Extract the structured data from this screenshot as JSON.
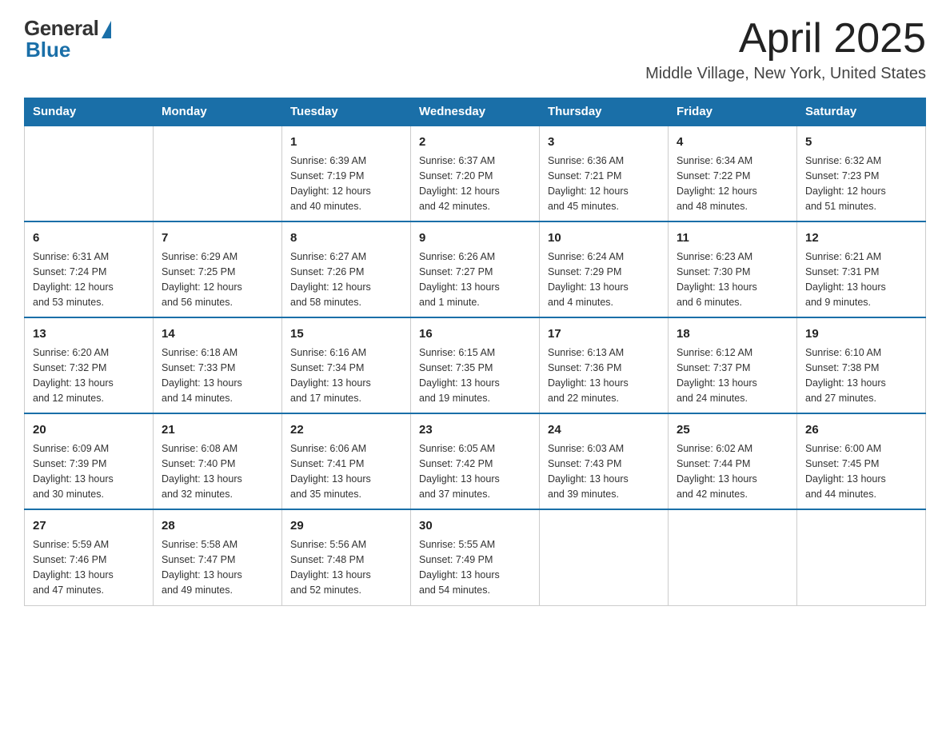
{
  "logo": {
    "general": "General",
    "blue": "Blue"
  },
  "title": "April 2025",
  "location": "Middle Village, New York, United States",
  "headers": [
    "Sunday",
    "Monday",
    "Tuesday",
    "Wednesday",
    "Thursday",
    "Friday",
    "Saturday"
  ],
  "weeks": [
    [
      {
        "day": "",
        "info": ""
      },
      {
        "day": "",
        "info": ""
      },
      {
        "day": "1",
        "info": "Sunrise: 6:39 AM\nSunset: 7:19 PM\nDaylight: 12 hours\nand 40 minutes."
      },
      {
        "day": "2",
        "info": "Sunrise: 6:37 AM\nSunset: 7:20 PM\nDaylight: 12 hours\nand 42 minutes."
      },
      {
        "day": "3",
        "info": "Sunrise: 6:36 AM\nSunset: 7:21 PM\nDaylight: 12 hours\nand 45 minutes."
      },
      {
        "day": "4",
        "info": "Sunrise: 6:34 AM\nSunset: 7:22 PM\nDaylight: 12 hours\nand 48 minutes."
      },
      {
        "day": "5",
        "info": "Sunrise: 6:32 AM\nSunset: 7:23 PM\nDaylight: 12 hours\nand 51 minutes."
      }
    ],
    [
      {
        "day": "6",
        "info": "Sunrise: 6:31 AM\nSunset: 7:24 PM\nDaylight: 12 hours\nand 53 minutes."
      },
      {
        "day": "7",
        "info": "Sunrise: 6:29 AM\nSunset: 7:25 PM\nDaylight: 12 hours\nand 56 minutes."
      },
      {
        "day": "8",
        "info": "Sunrise: 6:27 AM\nSunset: 7:26 PM\nDaylight: 12 hours\nand 58 minutes."
      },
      {
        "day": "9",
        "info": "Sunrise: 6:26 AM\nSunset: 7:27 PM\nDaylight: 13 hours\nand 1 minute."
      },
      {
        "day": "10",
        "info": "Sunrise: 6:24 AM\nSunset: 7:29 PM\nDaylight: 13 hours\nand 4 minutes."
      },
      {
        "day": "11",
        "info": "Sunrise: 6:23 AM\nSunset: 7:30 PM\nDaylight: 13 hours\nand 6 minutes."
      },
      {
        "day": "12",
        "info": "Sunrise: 6:21 AM\nSunset: 7:31 PM\nDaylight: 13 hours\nand 9 minutes."
      }
    ],
    [
      {
        "day": "13",
        "info": "Sunrise: 6:20 AM\nSunset: 7:32 PM\nDaylight: 13 hours\nand 12 minutes."
      },
      {
        "day": "14",
        "info": "Sunrise: 6:18 AM\nSunset: 7:33 PM\nDaylight: 13 hours\nand 14 minutes."
      },
      {
        "day": "15",
        "info": "Sunrise: 6:16 AM\nSunset: 7:34 PM\nDaylight: 13 hours\nand 17 minutes."
      },
      {
        "day": "16",
        "info": "Sunrise: 6:15 AM\nSunset: 7:35 PM\nDaylight: 13 hours\nand 19 minutes."
      },
      {
        "day": "17",
        "info": "Sunrise: 6:13 AM\nSunset: 7:36 PM\nDaylight: 13 hours\nand 22 minutes."
      },
      {
        "day": "18",
        "info": "Sunrise: 6:12 AM\nSunset: 7:37 PM\nDaylight: 13 hours\nand 24 minutes."
      },
      {
        "day": "19",
        "info": "Sunrise: 6:10 AM\nSunset: 7:38 PM\nDaylight: 13 hours\nand 27 minutes."
      }
    ],
    [
      {
        "day": "20",
        "info": "Sunrise: 6:09 AM\nSunset: 7:39 PM\nDaylight: 13 hours\nand 30 minutes."
      },
      {
        "day": "21",
        "info": "Sunrise: 6:08 AM\nSunset: 7:40 PM\nDaylight: 13 hours\nand 32 minutes."
      },
      {
        "day": "22",
        "info": "Sunrise: 6:06 AM\nSunset: 7:41 PM\nDaylight: 13 hours\nand 35 minutes."
      },
      {
        "day": "23",
        "info": "Sunrise: 6:05 AM\nSunset: 7:42 PM\nDaylight: 13 hours\nand 37 minutes."
      },
      {
        "day": "24",
        "info": "Sunrise: 6:03 AM\nSunset: 7:43 PM\nDaylight: 13 hours\nand 39 minutes."
      },
      {
        "day": "25",
        "info": "Sunrise: 6:02 AM\nSunset: 7:44 PM\nDaylight: 13 hours\nand 42 minutes."
      },
      {
        "day": "26",
        "info": "Sunrise: 6:00 AM\nSunset: 7:45 PM\nDaylight: 13 hours\nand 44 minutes."
      }
    ],
    [
      {
        "day": "27",
        "info": "Sunrise: 5:59 AM\nSunset: 7:46 PM\nDaylight: 13 hours\nand 47 minutes."
      },
      {
        "day": "28",
        "info": "Sunrise: 5:58 AM\nSunset: 7:47 PM\nDaylight: 13 hours\nand 49 minutes."
      },
      {
        "day": "29",
        "info": "Sunrise: 5:56 AM\nSunset: 7:48 PM\nDaylight: 13 hours\nand 52 minutes."
      },
      {
        "day": "30",
        "info": "Sunrise: 5:55 AM\nSunset: 7:49 PM\nDaylight: 13 hours\nand 54 minutes."
      },
      {
        "day": "",
        "info": ""
      },
      {
        "day": "",
        "info": ""
      },
      {
        "day": "",
        "info": ""
      }
    ]
  ]
}
